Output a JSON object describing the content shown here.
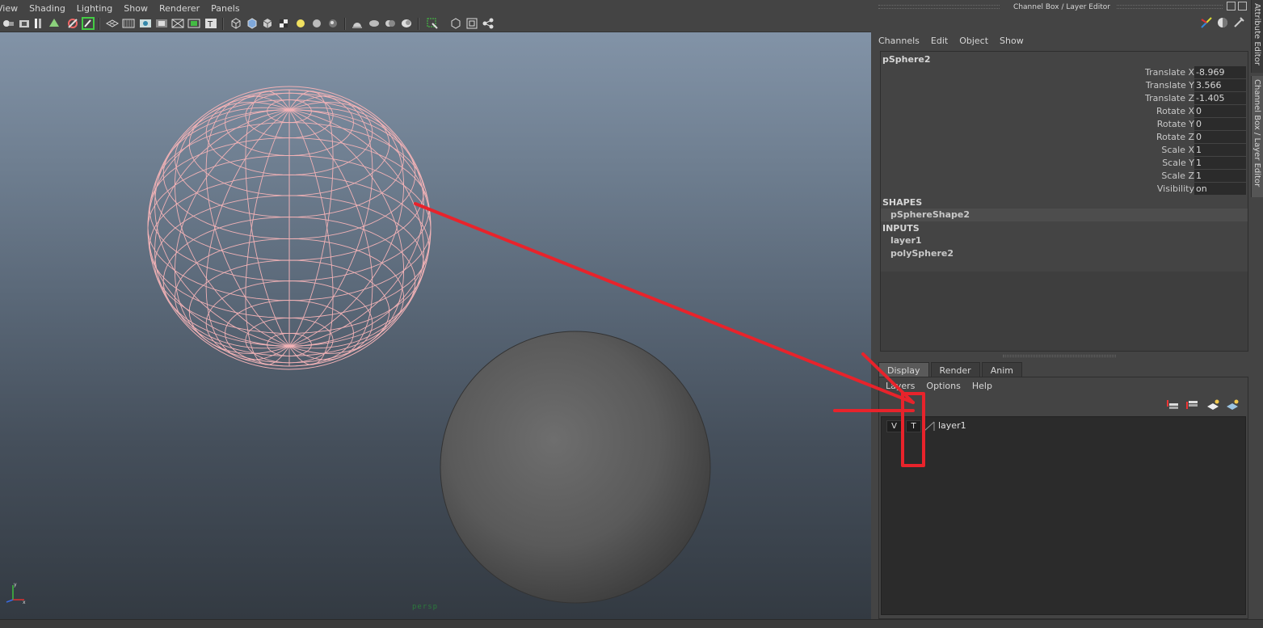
{
  "viewport": {
    "menus": [
      "View",
      "Shading",
      "Lighting",
      "Show",
      "Renderer",
      "Panels"
    ],
    "camera_label": "persp",
    "toolbar_icons": [
      "select-camera-icon",
      "camera-attributes-icon",
      "bookmark-icon",
      "image-plane-icon",
      "2d-pan-zoom-icon",
      "grease-pencil-icon",
      "grid-icon",
      "film-gate-icon",
      "resolution-gate-icon",
      "gate-mask-icon",
      "field-chart-icon",
      "safe-action-icon",
      "safe-title-icon",
      "wireframe-icon",
      "smooth-shade-icon",
      "wireframe-on-shaded-icon",
      "textured-icon",
      "use-all-lights-icon",
      "shadows-icon",
      "screen-space-ao-icon",
      "motion-blur-icon",
      "multisample-aa-icon",
      "depth-of-field-icon",
      "isolate-select-icon",
      "xray-icon",
      "xray-active-icon",
      "xray-joints-icon"
    ]
  },
  "dock": {
    "title": "Channel Box / Layer Editor",
    "side_tabs": [
      "Attribute Editor",
      "Channel Box / Layer Editor"
    ]
  },
  "channel_box": {
    "menus": [
      "Channels",
      "Edit",
      "Object",
      "Show"
    ],
    "node_name": "pSphere2",
    "attributes": [
      {
        "label": "Translate X",
        "value": "-8.969"
      },
      {
        "label": "Translate Y",
        "value": "3.566"
      },
      {
        "label": "Translate Z",
        "value": "-1.405"
      },
      {
        "label": "Rotate X",
        "value": "0"
      },
      {
        "label": "Rotate Y",
        "value": "0"
      },
      {
        "label": "Rotate Z",
        "value": "0"
      },
      {
        "label": "Scale X",
        "value": "1"
      },
      {
        "label": "Scale Y",
        "value": "1"
      },
      {
        "label": "Scale Z",
        "value": "1"
      },
      {
        "label": "Visibility",
        "value": "on"
      }
    ],
    "shapes_header": "SHAPES",
    "shapes": [
      "pSphereShape2"
    ],
    "inputs_header": "INPUTS",
    "inputs": [
      "layer1",
      "polySphere2"
    ]
  },
  "layer_editor": {
    "tabs": [
      "Display",
      "Render",
      "Anim"
    ],
    "active_tab": "Display",
    "menus": [
      "Layers",
      "Options",
      "Help"
    ],
    "icons": [
      "move-layer-up-icon",
      "move-layer-down-icon",
      "create-empty-layer-icon",
      "create-layer-from-selected-icon"
    ],
    "layers": [
      {
        "visible_label": "V",
        "display_type_label": "T",
        "name": "layer1"
      }
    ]
  },
  "colors": {
    "annotation": "#e8232b",
    "wireframe": "#f2b2b6",
    "viewport_top": "#8293a7",
    "viewport_bottom": "#333a42"
  }
}
